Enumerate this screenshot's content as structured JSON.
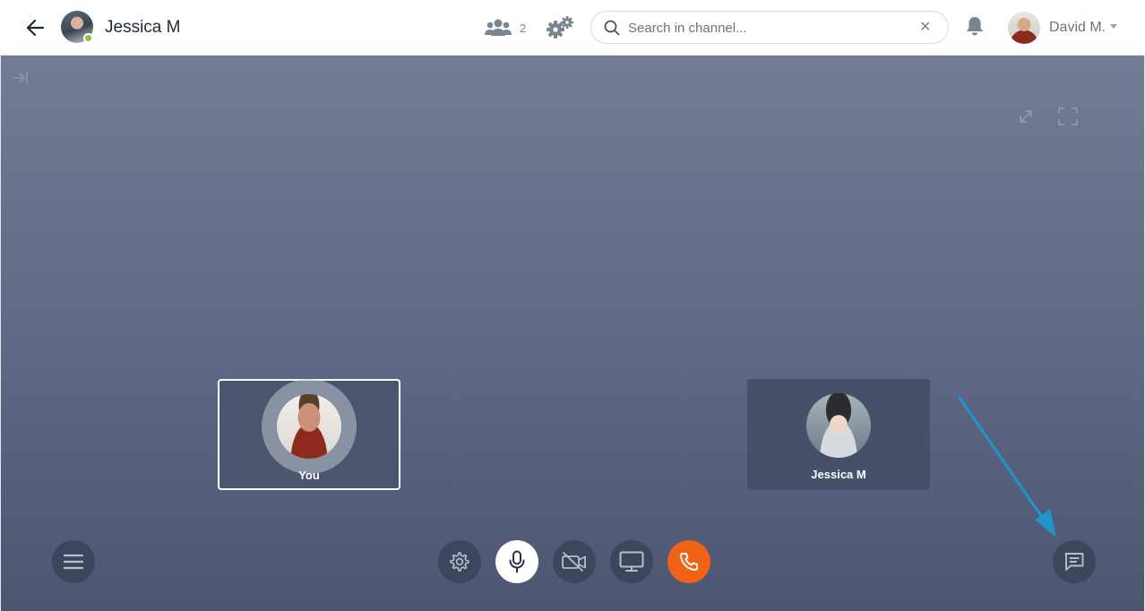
{
  "header": {
    "contact_name": "Jessica M",
    "participants_count": "2",
    "search": {
      "placeholder": "Search in channel...",
      "value": ""
    },
    "search_clear_glyph": "✕",
    "user_name": "David M."
  },
  "tiles": {
    "self_label": "You",
    "remote_label": "Jessica M"
  },
  "icons": {
    "back": "arrow-left-icon",
    "participants": "users-icon",
    "settings": "gears-icon",
    "search": "search-icon",
    "notifications": "bell-icon",
    "collapse": "collapse-panel-icon",
    "expand": "expand-icon",
    "fullscreen": "fullscreen-icon",
    "menu": "hamburger-icon",
    "call_settings": "gear-icon",
    "microphone": "microphone-icon",
    "camera": "camera-off-icon",
    "screen_share": "monitor-icon",
    "hangup": "phone-icon",
    "chat": "chat-icon"
  },
  "colors": {
    "presence_online": "#8bc34a",
    "hangup": "#f06214",
    "stage_top": "#737c94",
    "stage_bottom": "#4c5671",
    "annotation_arrow": "#1f95c9"
  }
}
